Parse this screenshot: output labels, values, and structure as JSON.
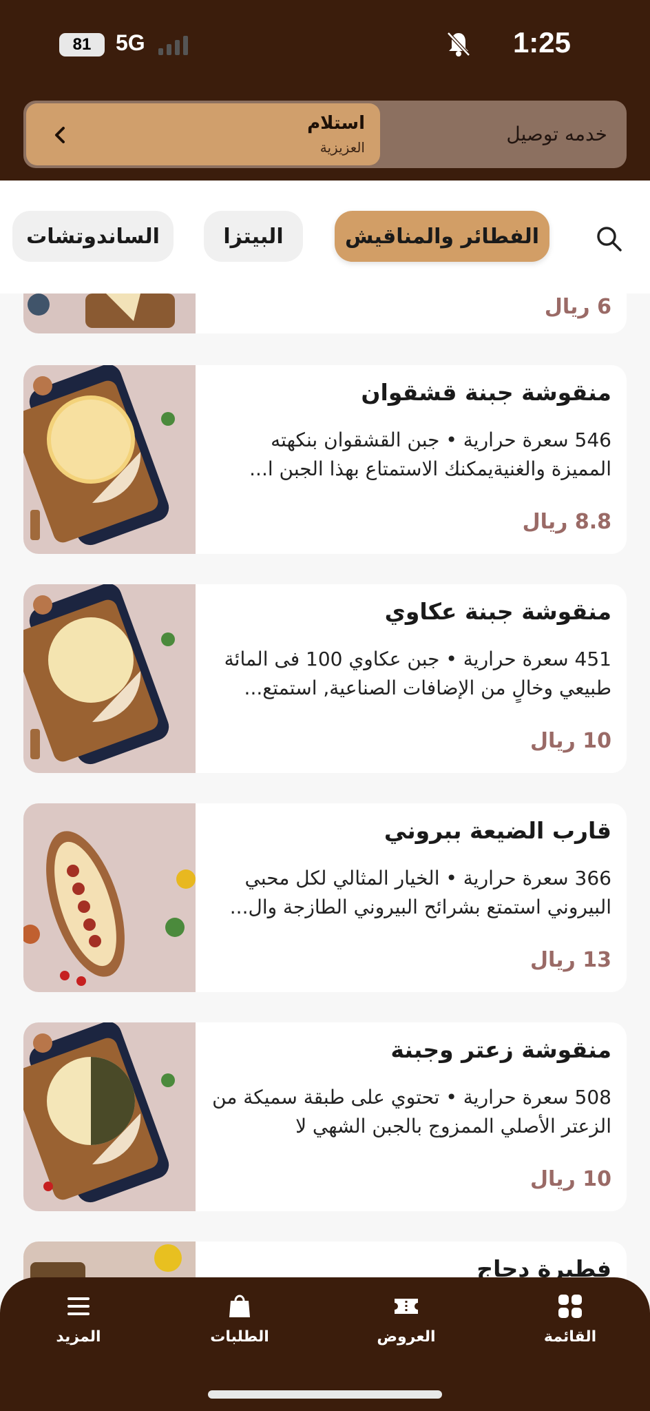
{
  "status_bar": {
    "time": "1:25",
    "battery": "81",
    "network": "5G"
  },
  "delivery": {
    "pickup_title": "استلام",
    "pickup_location": "العزيزية",
    "delivery_label": "خدمه توصيل"
  },
  "categories": [
    {
      "label": "الفطائر والمناقيش",
      "active": true
    },
    {
      "label": "البيتزا",
      "active": false
    },
    {
      "label": "الساندوتشات",
      "active": false
    }
  ],
  "products": [
    {
      "title": "",
      "description": "",
      "price": "6 ريال"
    },
    {
      "title": "منقوشة جبنة قشقوان",
      "description": "546 سعرة حرارية • جبن القشقوان بنكهته المميزة والغنيةيمكنك الاستمتاع بهذا الجبن ا...",
      "price": "8.8 ريال"
    },
    {
      "title": "منقوشة جبنة عكاوي",
      "description": "451 سعرة حرارية • جبن عكاوي 100 فى المائة طبيعي وخالٍ من الإضافات الصناعية, استمتع...",
      "price": "10 ريال"
    },
    {
      "title": "قارب الضيعة ببروني",
      "description": "366 سعرة حرارية • الخيار المثالي لكل محبي البيروني  استمتع بشرائح البيروني الطازجة وال...",
      "price": "13 ريال"
    },
    {
      "title": "منقوشة زعتر وجبنة",
      "description": "508 سعرة حرارية • تحتوي على طبقة سميكة من الزعتر الأصلي الممزوج بالجبن الشهي لا",
      "price": "10 ريال"
    },
    {
      "title": "فطيرة دجاج",
      "description": "",
      "price": ""
    }
  ],
  "bottom_nav": [
    {
      "label": "القائمة",
      "icon": "grid-icon"
    },
    {
      "label": "العروض",
      "icon": "ticket-icon"
    },
    {
      "label": "الطلبات",
      "icon": "bag-icon"
    },
    {
      "label": "المزيد",
      "icon": "menu-icon"
    }
  ],
  "colors": {
    "header": "#3b1d0c",
    "accent": "#d29e66",
    "price": "#9a6a66"
  }
}
